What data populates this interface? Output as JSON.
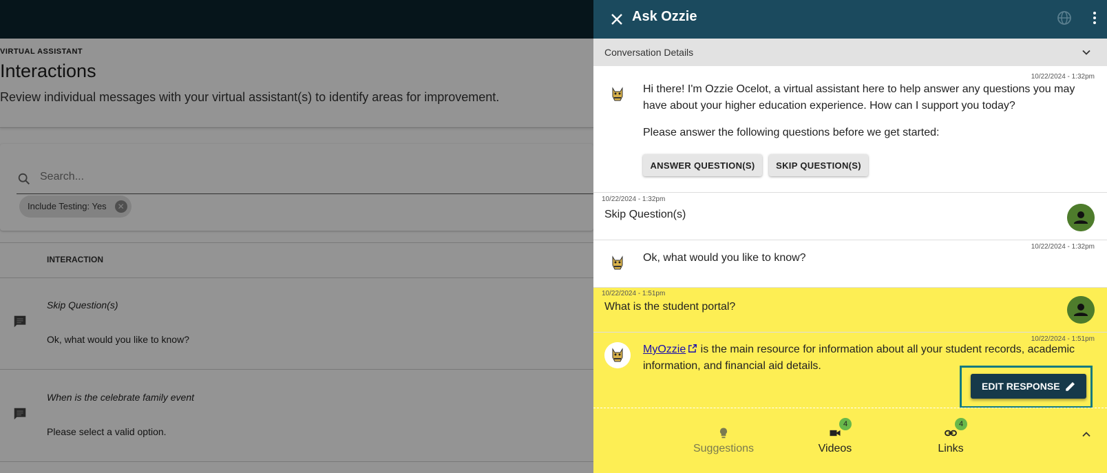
{
  "background": {
    "section_label": "VIRTUAL ASSISTANT",
    "title": "Interactions",
    "subtitle": "Review individual messages with your virtual assistant(s) to identify areas for improvement.",
    "search_placeholder": "Search...",
    "filter_chip": "Include Testing: Yes",
    "table_header": "INTERACTION",
    "rows": [
      {
        "question": "Skip Question(s)",
        "answer": "Ok, what would you like to know?"
      },
      {
        "question": "When is the celebrate family event",
        "answer": "Please select a valid option."
      }
    ]
  },
  "panel": {
    "title": "Ask Ozzie",
    "conversation_label": "Conversation Details",
    "messages": [
      {
        "timestamp": "10/22/2024 - 1:32pm",
        "text1": "Hi there! I'm Ozzie Ocelot, a virtual assistant here to help answer any questions you may",
        "text2": "have about your higher education experience. How can I support you today?",
        "text3": "Please answer the following questions before we get started:",
        "btn_answer": "ANSWER QUESTION(S)",
        "btn_skip": "SKIP QUESTION(S)"
      },
      {
        "timestamp": "10/22/2024 - 1:32pm",
        "text": "Skip Question(s)"
      },
      {
        "timestamp": "10/22/2024 - 1:32pm",
        "text": "Ok, what would you like to know?"
      },
      {
        "timestamp": "10/22/2024 - 1:51pm",
        "text": "What is the student portal?"
      },
      {
        "timestamp": "10/22/2024 - 1:51pm",
        "link": "MyOzzie",
        "text1": " is the main resource for information about all your student records, academic",
        "text2": "information, and financial aid details."
      }
    ],
    "edit_label": "EDIT RESPONSE",
    "footer_tabs": [
      {
        "label": "Suggestions",
        "icon": "lightbulb-icon"
      },
      {
        "label": "Videos",
        "icon": "video-icon",
        "badge": "4"
      },
      {
        "label": "Links",
        "icon": "link-icon",
        "badge": "4"
      }
    ],
    "colors": {
      "header": "#1b4a5e",
      "highlight": "#fdee54",
      "user_avatar": "#4e7c2c",
      "edit_button": "#16394a",
      "focus_frame": "#117a80"
    }
  }
}
